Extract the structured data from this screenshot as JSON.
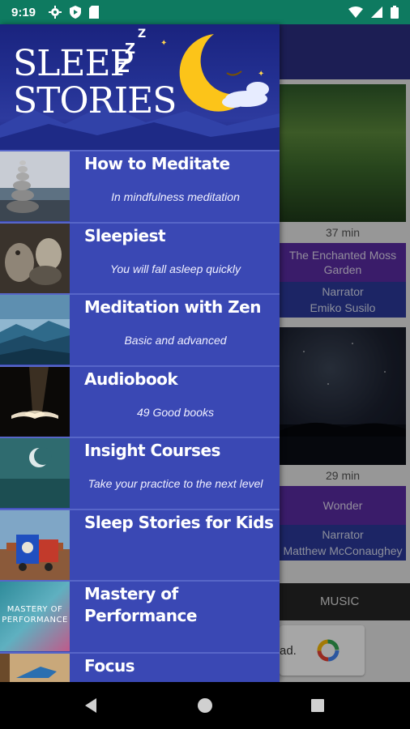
{
  "status_bar": {
    "time": "9:19"
  },
  "drawer": {
    "header": {
      "logo_line1": "SLEEP",
      "logo_line2": "STORIES",
      "zzz": "ZZZ"
    },
    "items": [
      {
        "label": "How to Meditate",
        "subtitle": "In mindfulness meditation"
      },
      {
        "label": "Sleepiest",
        "subtitle": "You will fall asleep quickly"
      },
      {
        "label": "Meditation with Zen",
        "subtitle": "Basic and advanced"
      },
      {
        "label": "Audiobook",
        "subtitle": "49 Good books"
      },
      {
        "label": "Insight Courses",
        "subtitle": "Take your practice to the next level"
      },
      {
        "label": "Sleep Stories for Kids",
        "subtitle": ""
      },
      {
        "label": "Mastery of Performance",
        "subtitle": "",
        "thumb_text": "MASTERY OF PERFORMANCE"
      },
      {
        "label": "Focus",
        "subtitle": ""
      }
    ]
  },
  "content": {
    "cards": [
      {
        "duration": "37 min",
        "title": "The Enchanted Moss Garden",
        "narrator_label": "Narrator",
        "narrator_name": "Emiko Susilo"
      },
      {
        "duration": "29 min",
        "title": "Wonder",
        "narrator_label": "Narrator",
        "narrator_name": "Matthew McConaughey"
      }
    ],
    "music_tab": "MUSIC",
    "ad_text": "ad."
  }
}
